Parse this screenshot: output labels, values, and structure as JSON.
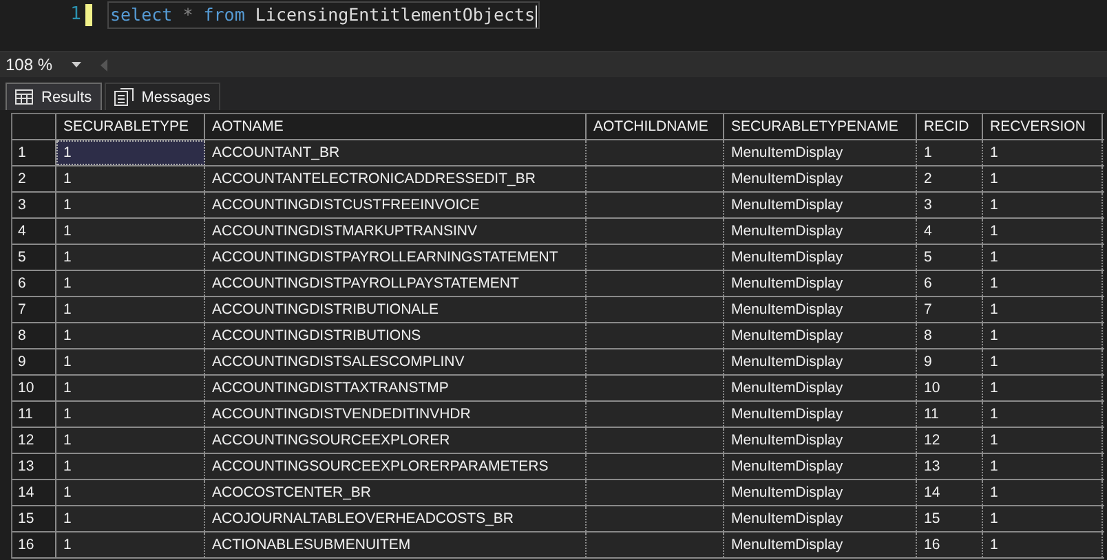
{
  "editor": {
    "line_number": "1",
    "tokens": [
      {
        "text": "select",
        "kind": "keyword"
      },
      {
        "text": "*",
        "kind": "operator"
      },
      {
        "text": "from",
        "kind": "keyword"
      },
      {
        "text": "LicensingEntitlementObjects",
        "kind": "identifier"
      }
    ]
  },
  "zoom": {
    "value": "108 %"
  },
  "tabs": [
    {
      "label": "Results",
      "selected": true
    },
    {
      "label": "Messages",
      "selected": false
    }
  ],
  "table": {
    "columns": [
      "SECURABLETYPE",
      "AOTNAME",
      "AOTCHILDNAME",
      "SECURABLETYPENAME",
      "RECID",
      "RECVERSION"
    ],
    "rows": [
      {
        "row_number": "1",
        "selected": true,
        "cells": [
          "1",
          "ACCOUNTANT_BR",
          "",
          "MenuItemDisplay",
          "1",
          "1"
        ]
      },
      {
        "row_number": "2",
        "selected": false,
        "cells": [
          "1",
          "ACCOUNTANTELECTRONICADDRESSEDIT_BR",
          "",
          "MenuItemDisplay",
          "2",
          "1"
        ]
      },
      {
        "row_number": "3",
        "selected": false,
        "cells": [
          "1",
          "ACCOUNTINGDISTCUSTFREEINVOICE",
          "",
          "MenuItemDisplay",
          "3",
          "1"
        ]
      },
      {
        "row_number": "4",
        "selected": false,
        "cells": [
          "1",
          "ACCOUNTINGDISTMARKUPTRANSINV",
          "",
          "MenuItemDisplay",
          "4",
          "1"
        ]
      },
      {
        "row_number": "5",
        "selected": false,
        "cells": [
          "1",
          "ACCOUNTINGDISTPAYROLLEARNINGSTATEMENT",
          "",
          "MenuItemDisplay",
          "5",
          "1"
        ]
      },
      {
        "row_number": "6",
        "selected": false,
        "cells": [
          "1",
          "ACCOUNTINGDISTPAYROLLPAYSTATEMENT",
          "",
          "MenuItemDisplay",
          "6",
          "1"
        ]
      },
      {
        "row_number": "7",
        "selected": false,
        "cells": [
          "1",
          "ACCOUNTINGDISTRIBUTIONALE",
          "",
          "MenuItemDisplay",
          "7",
          "1"
        ]
      },
      {
        "row_number": "8",
        "selected": false,
        "cells": [
          "1",
          "ACCOUNTINGDISTRIBUTIONS",
          "",
          "MenuItemDisplay",
          "8",
          "1"
        ]
      },
      {
        "row_number": "9",
        "selected": false,
        "cells": [
          "1",
          "ACCOUNTINGDISTSALESCOMPLINV",
          "",
          "MenuItemDisplay",
          "9",
          "1"
        ]
      },
      {
        "row_number": "10",
        "selected": false,
        "cells": [
          "1",
          "ACCOUNTINGDISTTAXTRANSTMP",
          "",
          "MenuItemDisplay",
          "10",
          "1"
        ]
      },
      {
        "row_number": "11",
        "selected": false,
        "cells": [
          "1",
          "ACCOUNTINGDISTVENDEDITINVHDR",
          "",
          "MenuItemDisplay",
          "11",
          "1"
        ]
      },
      {
        "row_number": "12",
        "selected": false,
        "cells": [
          "1",
          "ACCOUNTINGSOURCEEXPLORER",
          "",
          "MenuItemDisplay",
          "12",
          "1"
        ]
      },
      {
        "row_number": "13",
        "selected": false,
        "cells": [
          "1",
          "ACCOUNTINGSOURCEEXPLORERPARAMETERS",
          "",
          "MenuItemDisplay",
          "13",
          "1"
        ]
      },
      {
        "row_number": "14",
        "selected": false,
        "cells": [
          "1",
          "ACOCOSTCENTER_BR",
          "",
          "MenuItemDisplay",
          "14",
          "1"
        ]
      },
      {
        "row_number": "15",
        "selected": false,
        "cells": [
          "1",
          "ACOJOURNALTABLEOVERHEADCOSTS_BR",
          "",
          "MenuItemDisplay",
          "15",
          "1"
        ]
      },
      {
        "row_number": "16",
        "selected": false,
        "cells": [
          "1",
          "ACTIONABLESUBMENUITEM",
          "",
          "MenuItemDisplay",
          "16",
          "1"
        ]
      }
    ]
  }
}
